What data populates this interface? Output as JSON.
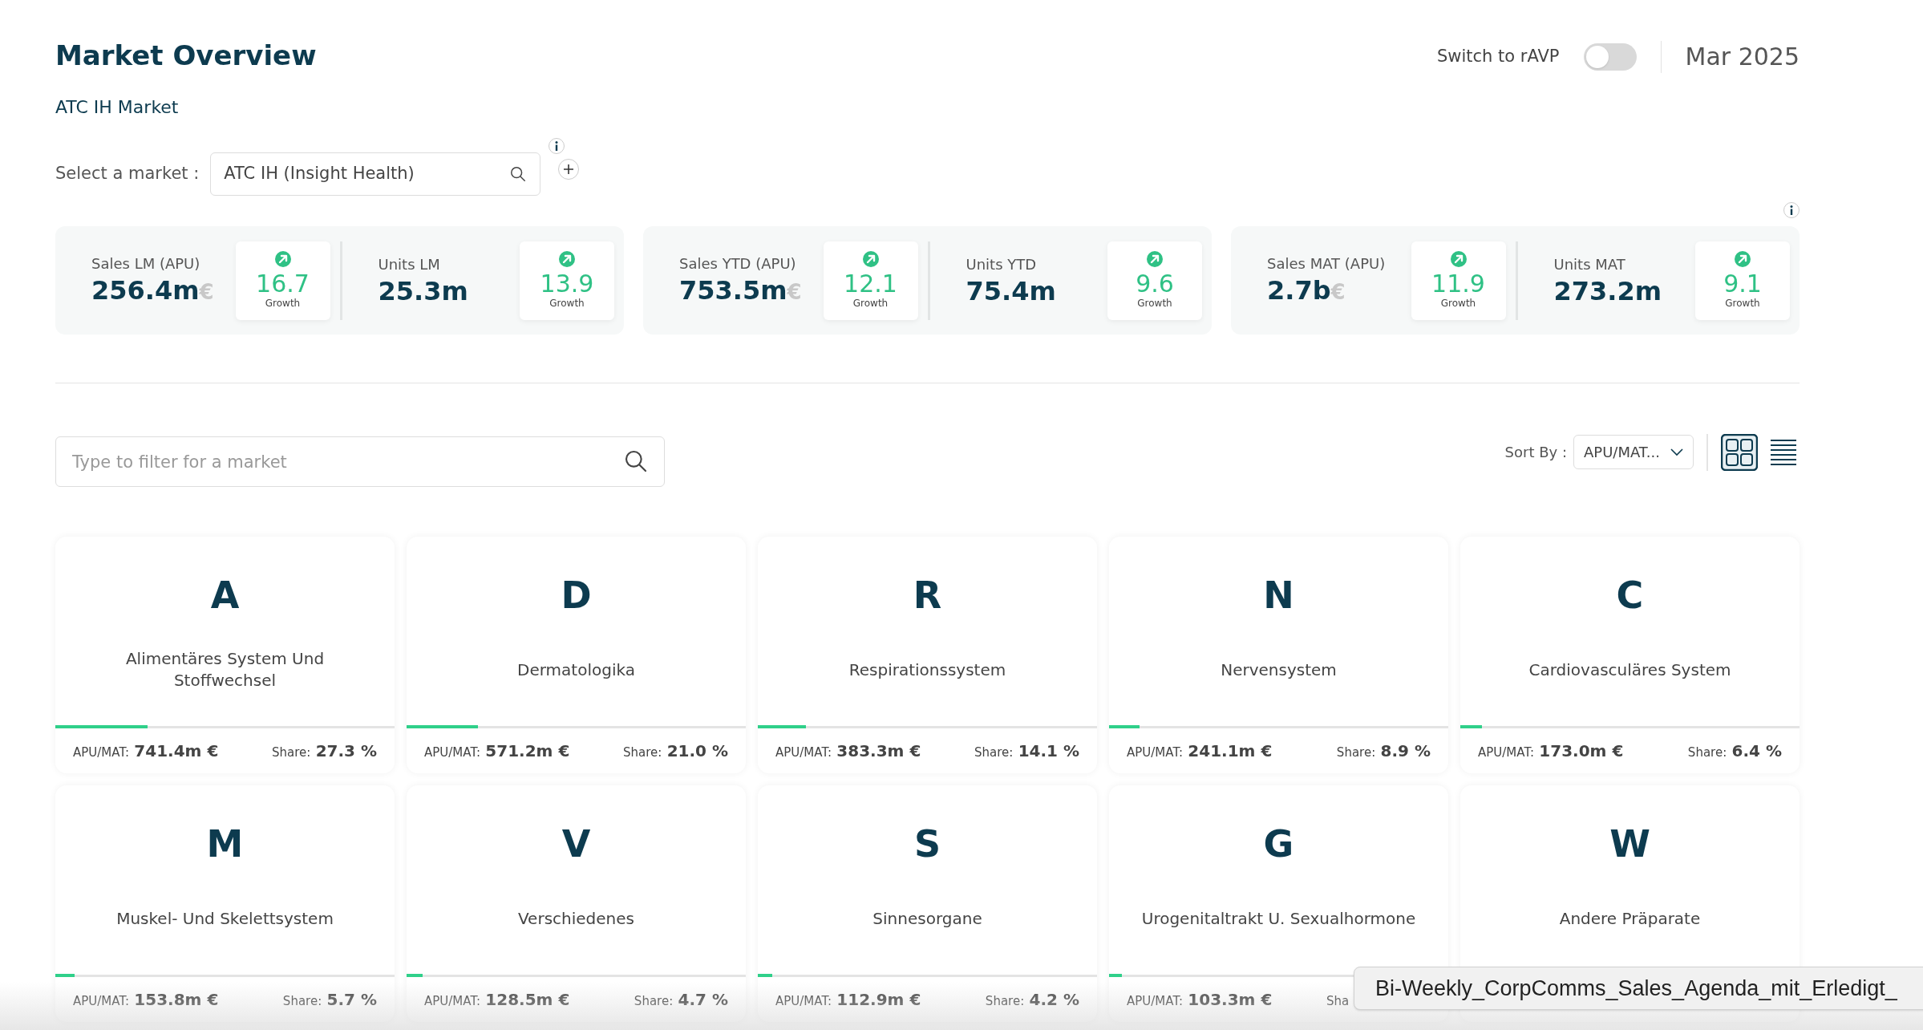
{
  "header": {
    "title": "Market Overview",
    "subtitle": "ATC IH Market",
    "toggle_label": "Switch to rAVP",
    "toggle_on": false,
    "date": "Mar 2025"
  },
  "market_select": {
    "label": "Select a market :",
    "value": "ATC IH (Insight Health)"
  },
  "kpi_groups": [
    {
      "items": [
        {
          "label": "Sales LM (APU)",
          "value": "256.4m",
          "unit": "€",
          "growth": "16.7",
          "growth_label": "Growth"
        },
        {
          "label": "Units LM",
          "value": "25.3m",
          "growth": "13.9",
          "growth_label": "Growth"
        }
      ]
    },
    {
      "items": [
        {
          "label": "Sales YTD (APU)",
          "value": "753.5m",
          "unit": "€",
          "growth": "12.1",
          "growth_label": "Growth"
        },
        {
          "label": "Units YTD",
          "value": "75.4m",
          "growth": "9.6",
          "growth_label": "Growth"
        }
      ]
    },
    {
      "items": [
        {
          "label": "Sales MAT (APU)",
          "value": "2.7b",
          "unit": "€",
          "growth": "11.9",
          "growth_label": "Growth"
        },
        {
          "label": "Units MAT",
          "value": "273.2m",
          "growth": "9.1",
          "growth_label": "Growth"
        }
      ]
    }
  ],
  "filter": {
    "placeholder": "Type to filter for a market"
  },
  "sort": {
    "label": "Sort By :",
    "value": "APU/MAT..."
  },
  "view_modes": [
    {
      "kind": "grid",
      "selected": true
    },
    {
      "kind": "list",
      "selected": false
    }
  ],
  "cards": [
    {
      "letter": "A",
      "name": "Alimentäres System Und Stoffwechsel",
      "level": 0.273,
      "apu_label": "APU/MAT:",
      "apu": "741.4m €",
      "share_label": "Share:",
      "share": "27.3 %"
    },
    {
      "letter": "D",
      "name": "Dermatologika",
      "level": 0.21,
      "apu_label": "APU/MAT:",
      "apu": "571.2m €",
      "share_label": "Share:",
      "share": "21.0 %"
    },
    {
      "letter": "R",
      "name": "Respirationssystem",
      "level": 0.141,
      "apu_label": "APU/MAT:",
      "apu": "383.3m €",
      "share_label": "Share:",
      "share": "14.1 %"
    },
    {
      "letter": "N",
      "name": "Nervensystem",
      "level": 0.089,
      "apu_label": "APU/MAT:",
      "apu": "241.1m €",
      "share_label": "Share:",
      "share": "8.9 %"
    },
    {
      "letter": "C",
      "name": "Cardiovasculäres System",
      "level": 0.064,
      "apu_label": "APU/MAT:",
      "apu": "173.0m €",
      "share_label": "Share:",
      "share": "6.4 %"
    },
    {
      "letter": "M",
      "name": "Muskel- Und Skelettsystem",
      "level": 0.057,
      "apu_label": "APU/MAT:",
      "apu": "153.8m €",
      "share_label": "Share:",
      "share": "5.7 %"
    },
    {
      "letter": "V",
      "name": "Verschiedenes",
      "level": 0.047,
      "apu_label": "APU/MAT:",
      "apu": "128.5m €",
      "share_label": "Share:",
      "share": "4.7 %"
    },
    {
      "letter": "S",
      "name": "Sinnesorgane",
      "level": 0.042,
      "apu_label": "APU/MAT:",
      "apu": "112.9m €",
      "share_label": "Share:",
      "share": "4.2 %"
    },
    {
      "letter": "G",
      "name": "Urogenitaltrakt U. Sexualhormone",
      "level": 0.038,
      "apu_label": "APU/MAT:",
      "apu": "103.3m €",
      "share_label": "Sha"
    },
    {
      "letter": "W",
      "name": "Andere Präparate"
    }
  ],
  "tooltip": {
    "text": "Bi-Weekly_CorpComms_Sales_Agenda_mit_Erledigt_"
  }
}
